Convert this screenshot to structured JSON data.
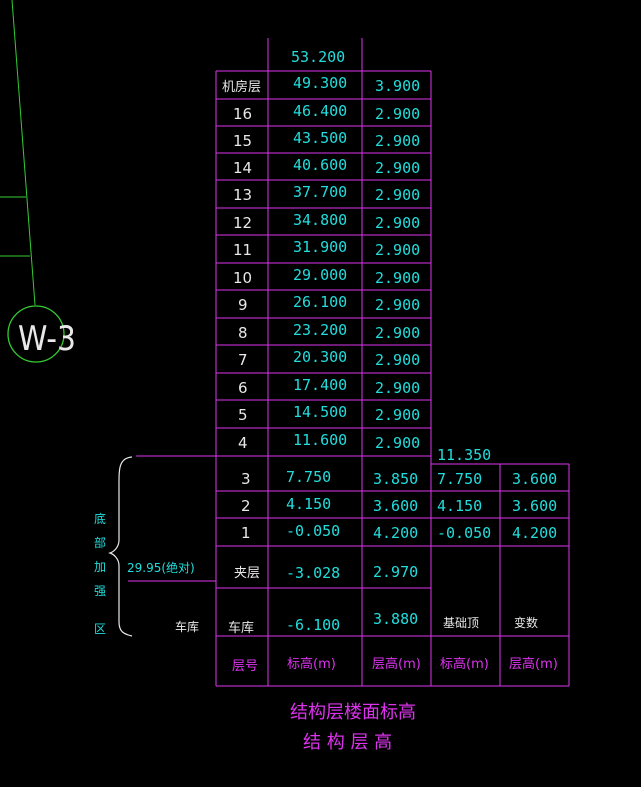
{
  "axis_label": "W-3",
  "top_elevation": "53.200",
  "tower_rows": [
    {
      "floor": "机房层",
      "elev": "49.300",
      "height": "3.900"
    },
    {
      "floor": "16",
      "elev": "46.400",
      "height": "2.900"
    },
    {
      "floor": "15",
      "elev": "43.500",
      "height": "2.900"
    },
    {
      "floor": "14",
      "elev": "40.600",
      "height": "2.900"
    },
    {
      "floor": "13",
      "elev": "37.700",
      "height": "2.900"
    },
    {
      "floor": "12",
      "elev": "34.800",
      "height": "2.900"
    },
    {
      "floor": "11",
      "elev": "31.900",
      "height": "2.900"
    },
    {
      "floor": "10",
      "elev": "29.000",
      "height": "2.900"
    },
    {
      "floor": "9",
      "elev": "26.100",
      "height": "2.900"
    },
    {
      "floor": "8",
      "elev": "23.200",
      "height": "2.900"
    },
    {
      "floor": "7",
      "elev": "20.300",
      "height": "2.900"
    },
    {
      "floor": "6",
      "elev": "17.400",
      "height": "2.900"
    },
    {
      "floor": "5",
      "elev": "14.500",
      "height": "2.900"
    },
    {
      "floor": "4",
      "elev": "11.600",
      "height": "2.900"
    }
  ],
  "podium_top_elevation": "11.350",
  "lower_rows": [
    {
      "floor": "3",
      "elev": "7.750",
      "height": "3.850",
      "elev2": "7.750",
      "height2": "3.600"
    },
    {
      "floor": "2",
      "elev": "4.150",
      "height": "3.600",
      "elev2": "4.150",
      "height2": "3.600"
    },
    {
      "floor": "1",
      "elev": "-0.050",
      "height": "4.200",
      "elev2": "-0.050",
      "height2": "4.200"
    }
  ],
  "mezzanine": {
    "floor": "夹层",
    "elev": "-3.028",
    "height": "2.970"
  },
  "garage": {
    "floor": "车库",
    "elev": "-6.100",
    "height": "3.880",
    "left_label": "车库",
    "foundation_top": "基础顶",
    "variable": "变数"
  },
  "footer": {
    "floor_no": "层号",
    "elev": "标高(m)",
    "height": "层高(m)",
    "elev2": "标高(m)",
    "height2": "层高(m)"
  },
  "bracket_label": [
    "底",
    "部",
    "加",
    "强",
    "区"
  ],
  "absolute_elevation": "29.95(绝对)",
  "title_line1": "结构层楼面标高",
  "title_line2": "结 构 层 高",
  "colors": {
    "background": "#000000",
    "grid": "#dd33ee",
    "values": "#22dddd",
    "text": "#e8e8e8",
    "axis": "#33cc33"
  }
}
